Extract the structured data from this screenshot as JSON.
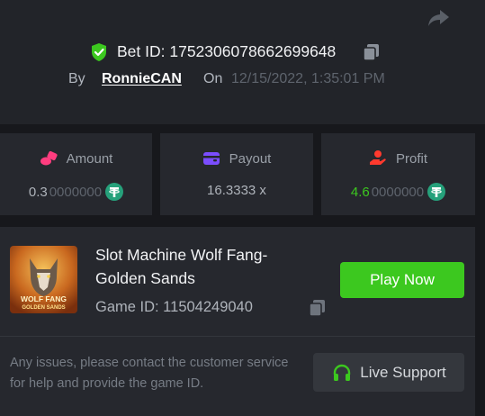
{
  "header": {
    "bet_id_label": "Bet ID: 1752306078662699648",
    "by_label": "By",
    "username": "RonnieCAN",
    "on_label": "On",
    "datetime": "12/15/2022, 1:35:01 PM"
  },
  "stats": {
    "amount": {
      "label": "Amount",
      "value_bright": "0.3",
      "value_dim": "0000000",
      "icon": "coins-icon",
      "color": "#ff3d7f"
    },
    "payout": {
      "label": "Payout",
      "value": "16.3333 x",
      "icon": "wallet-icon",
      "color": "#7b4dff"
    },
    "profit": {
      "label": "Profit",
      "value_bright": "4.6",
      "value_dim": "0000000",
      "icon": "hand-coin-icon",
      "color": "#ff3a2e"
    }
  },
  "game": {
    "title": "Slot Machine Wolf Fang-Golden Sands",
    "game_id_label": "Game ID: 11504249040",
    "thumb_text_line1": "WOLF FANG",
    "thumb_text_line2": "GOLDEN SANDS",
    "play_label": "Play Now"
  },
  "support": {
    "notice": "Any issues, please contact the customer service for help and provide the game ID.",
    "button_label": "Live Support"
  },
  "colors": {
    "accent_green": "#3cc81f",
    "tether_green": "#26a17b",
    "background": "#222429",
    "card": "#26282e"
  }
}
